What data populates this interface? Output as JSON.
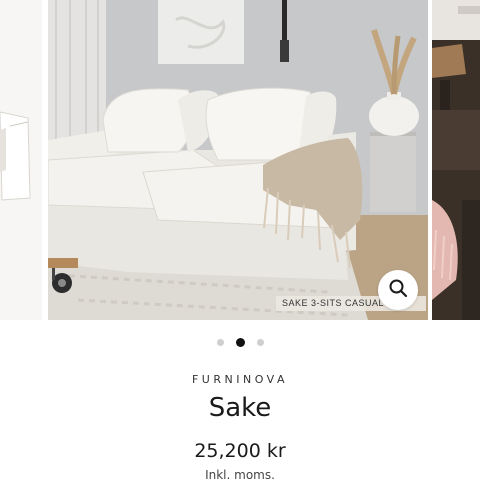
{
  "gallery": {
    "main_image_caption": "SAKE 3-SITS CASUAL",
    "zoom_icon": "magnifier-icon",
    "dots_count": 3,
    "active_dot_index": 1
  },
  "product": {
    "brand": "FURNINOVA",
    "name": "Sake",
    "price": "25,200 kr",
    "tax_note": "Inkl. moms."
  }
}
